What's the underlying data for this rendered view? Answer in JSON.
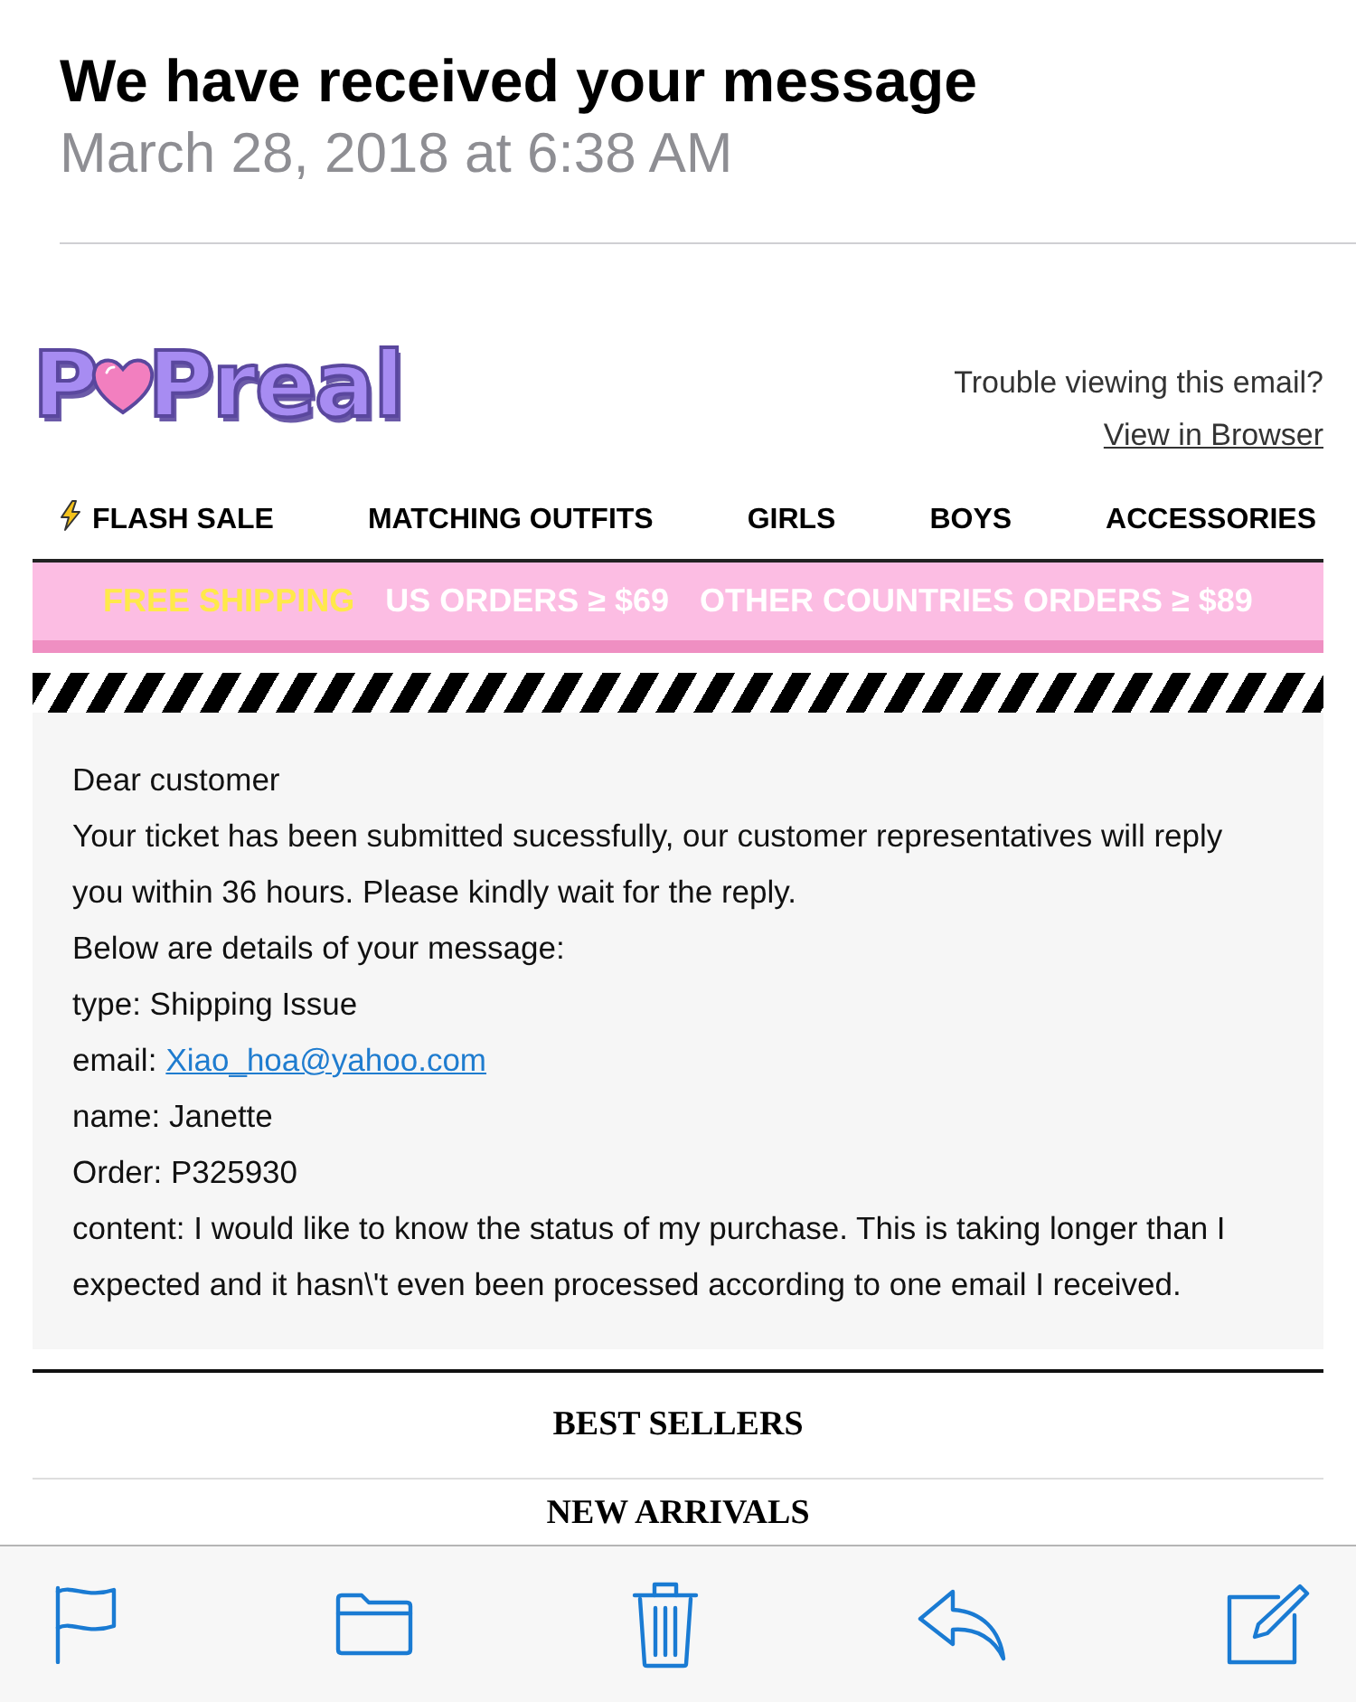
{
  "message": {
    "subject": "We have received your message",
    "date": "March 28, 2018 at 6:38 AM"
  },
  "email": {
    "logo": {
      "text_before_heart": "P",
      "text_after_heart": "Preal"
    },
    "header_note": "Trouble viewing this email?",
    "view_link": "View in Browser",
    "nav": [
      {
        "label": "FLASH SALE",
        "kind": "flash"
      },
      {
        "label": "MATCHING OUTFITS",
        "kind": "plain"
      },
      {
        "label": "GIRLS",
        "kind": "plain"
      },
      {
        "label": "BOYS",
        "kind": "plain"
      },
      {
        "label": "ACCESSORIES",
        "kind": "plain"
      }
    ],
    "banner": [
      {
        "text": "FREE SHIPPING",
        "kind": "highlight"
      },
      {
        "text": "US ORDERS ≥ $69",
        "kind": "plain"
      },
      {
        "text": "OTHER COUNTRIES ORDERS ≥ $89",
        "kind": "plain"
      }
    ],
    "body": [
      {
        "kind": "text",
        "text": "Dear customer"
      },
      {
        "kind": "text",
        "text": "Your ticket has been submitted sucessfully, our customer representatives will reply you within 36 hours. Please kindly wait for the reply."
      },
      {
        "kind": "text",
        "text": "Below are details of your message:"
      },
      {
        "kind": "text",
        "text": "type: Shipping Issue"
      },
      {
        "kind": "link",
        "label": "email:",
        "link": "Xiao_hoa@yahoo.com"
      },
      {
        "kind": "text",
        "text": "name: Janette"
      },
      {
        "kind": "text",
        "text": "Order: P325930"
      },
      {
        "kind": "text",
        "text": "content: I would like to know the status of my purchase. This is taking longer than I expected and it hasn\\'t even been processed according to one email I received."
      }
    ],
    "footer_links": [
      "BEST SELLERS",
      "NEW ARRIVALS"
    ]
  },
  "toolbar": [
    {
      "kind": "flag"
    },
    {
      "kind": "folder"
    },
    {
      "kind": "trash"
    },
    {
      "kind": "reply"
    },
    {
      "kind": "compose"
    }
  ]
}
